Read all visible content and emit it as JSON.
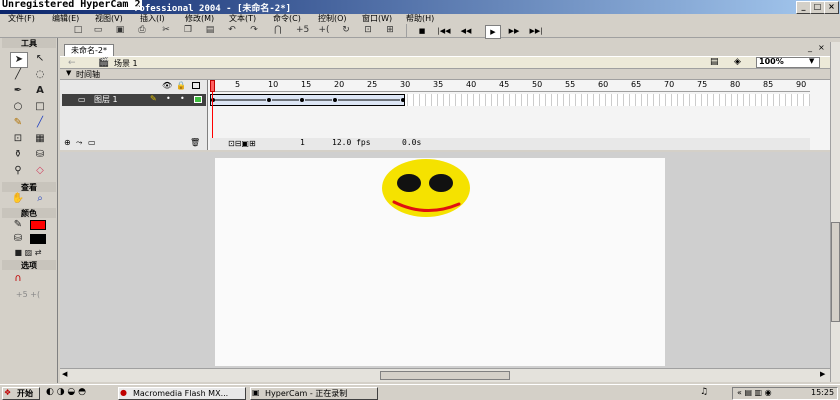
{
  "window": {
    "watermark": "Unregistered HyperCam 2",
    "title": "rofessional 2004 - [未命名-2*]",
    "min": "_",
    "max": "□",
    "close": "×"
  },
  "menu": [
    "文件(F)",
    "编辑(E)",
    "视图(V)",
    "插入(I)",
    "修改(M)",
    "文本(T)",
    "命令(C)",
    "控制(O)",
    "窗口(W)",
    "帮助(H)"
  ],
  "controls": [
    "■",
    "|◀◀",
    "◀◀",
    "▶",
    "▶▶",
    "▶▶|"
  ],
  "tools": {
    "title": "工具",
    "view_title": "查看",
    "colors_title": "颜色",
    "options_title": "选项"
  },
  "document": {
    "tab": "未命名-2*",
    "scene": "场景 1",
    "zoom": "100%"
  },
  "timeline": {
    "label": "时间轴",
    "layer_name": "图层 1",
    "ticks": [
      "1",
      "5",
      "10",
      "15",
      "20",
      "25",
      "30",
      "35",
      "40",
      "45",
      "50",
      "55",
      "60",
      "65",
      "70",
      "75",
      "80",
      "85",
      "90"
    ],
    "current_frame": "1",
    "fps": "12.0 fps",
    "time": "0.0s"
  },
  "taskbar": {
    "start": "开始",
    "tasks": [
      "Macromedia Flash MX...",
      "HyperCam - 正在录制"
    ],
    "clock": "15:25"
  },
  "colors": {
    "smiley_face": "#f5e200",
    "smiley_eyes": "#111111",
    "smiley_mouth": "#e01010",
    "fill_color": "#ff0000"
  }
}
